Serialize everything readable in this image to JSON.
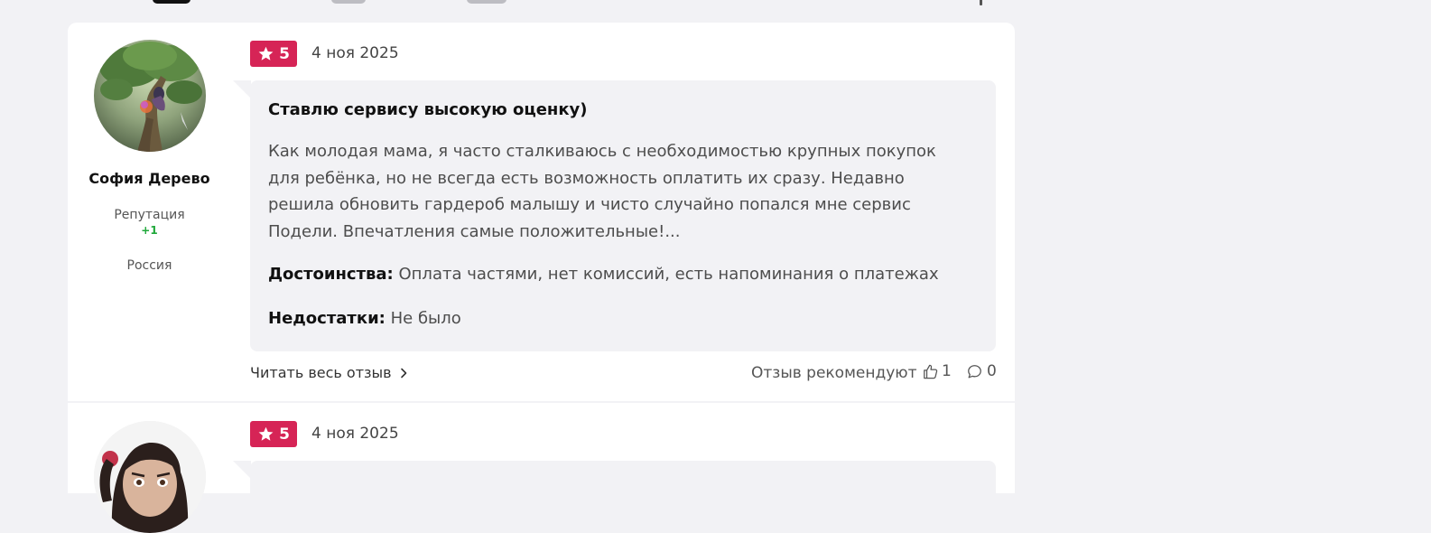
{
  "colors": {
    "page_bg": "#f2f2f5",
    "card_bg": "#ffffff",
    "rating_badge": "#d62456",
    "reputation_positive": "#1fa83a"
  },
  "reviews": [
    {
      "author": "София Дерево",
      "reputation_label": "Репутация",
      "reputation_value": "+1",
      "country": "Россия",
      "rating": "5",
      "date": "4 ноя 2025",
      "title": "Ставлю сервису высокую оценку)",
      "body": "Как молодая мама, я часто сталкиваюсь с необходимостью крупных покупок для ребёнка, но не всегда есть возможность оплатить их сразу. Недавно решила обновить гардероб малышу и чисто случайно попался мне сервис Подели. Впечатления самые положительные!...",
      "pros_label": "Достоинства:",
      "pros": "Оплата частями, нет комиссий, есть напоминания о платежах",
      "cons_label": "Недостатки:",
      "cons": "Не было",
      "read_more": "Читать весь отзыв",
      "recommend_label": "Отзыв рекомендуют",
      "likes": "1",
      "comments": "0",
      "avatar_icon": "fantasy-tree-woman-avatar"
    },
    {
      "rating": "5",
      "date": "4 ноя 2025",
      "avatar_icon": "woman-portrait-avatar"
    }
  ]
}
